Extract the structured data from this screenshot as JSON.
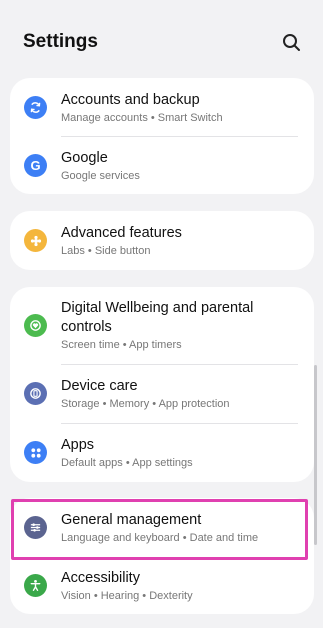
{
  "header": {
    "title": "Settings",
    "search_icon": "search-icon"
  },
  "cards": {
    "accounts": {
      "label": "Accounts and backup",
      "sub": "Manage accounts  •  Smart Switch",
      "icon": "sync-icon",
      "color": "#3d7ff5"
    },
    "google": {
      "label": "Google",
      "sub": "Google services",
      "icon": "google-icon",
      "color": "#3d7ff5"
    },
    "advanced": {
      "label": "Advanced features",
      "sub": "Labs  •  Side button",
      "icon": "puzzle-icon",
      "color": "#f4b63c"
    },
    "wellbeing": {
      "label_line1": "Digital Wellbeing and parental",
      "label_line2": "controls",
      "sub": "Screen time  •  App timers",
      "icon": "wellbeing-icon",
      "color": "#4cbb4f"
    },
    "devicecare": {
      "label": "Device care",
      "sub": "Storage  •  Memory  •  App protection",
      "icon": "device-care-icon",
      "color": "#5b6fb3"
    },
    "apps": {
      "label": "Apps",
      "sub": "Default apps  •  App settings",
      "icon": "apps-icon",
      "color": "#3d7ff5"
    },
    "general": {
      "label": "General management",
      "sub": "Language and keyboard  •  Date and time",
      "icon": "sliders-icon",
      "color": "#5b6490"
    },
    "accessibility": {
      "label": "Accessibility",
      "sub": "Vision  •  Hearing  •  Dexterity",
      "icon": "accessibility-icon",
      "color": "#3aa84a"
    }
  },
  "highlight_color": "#e040b0"
}
